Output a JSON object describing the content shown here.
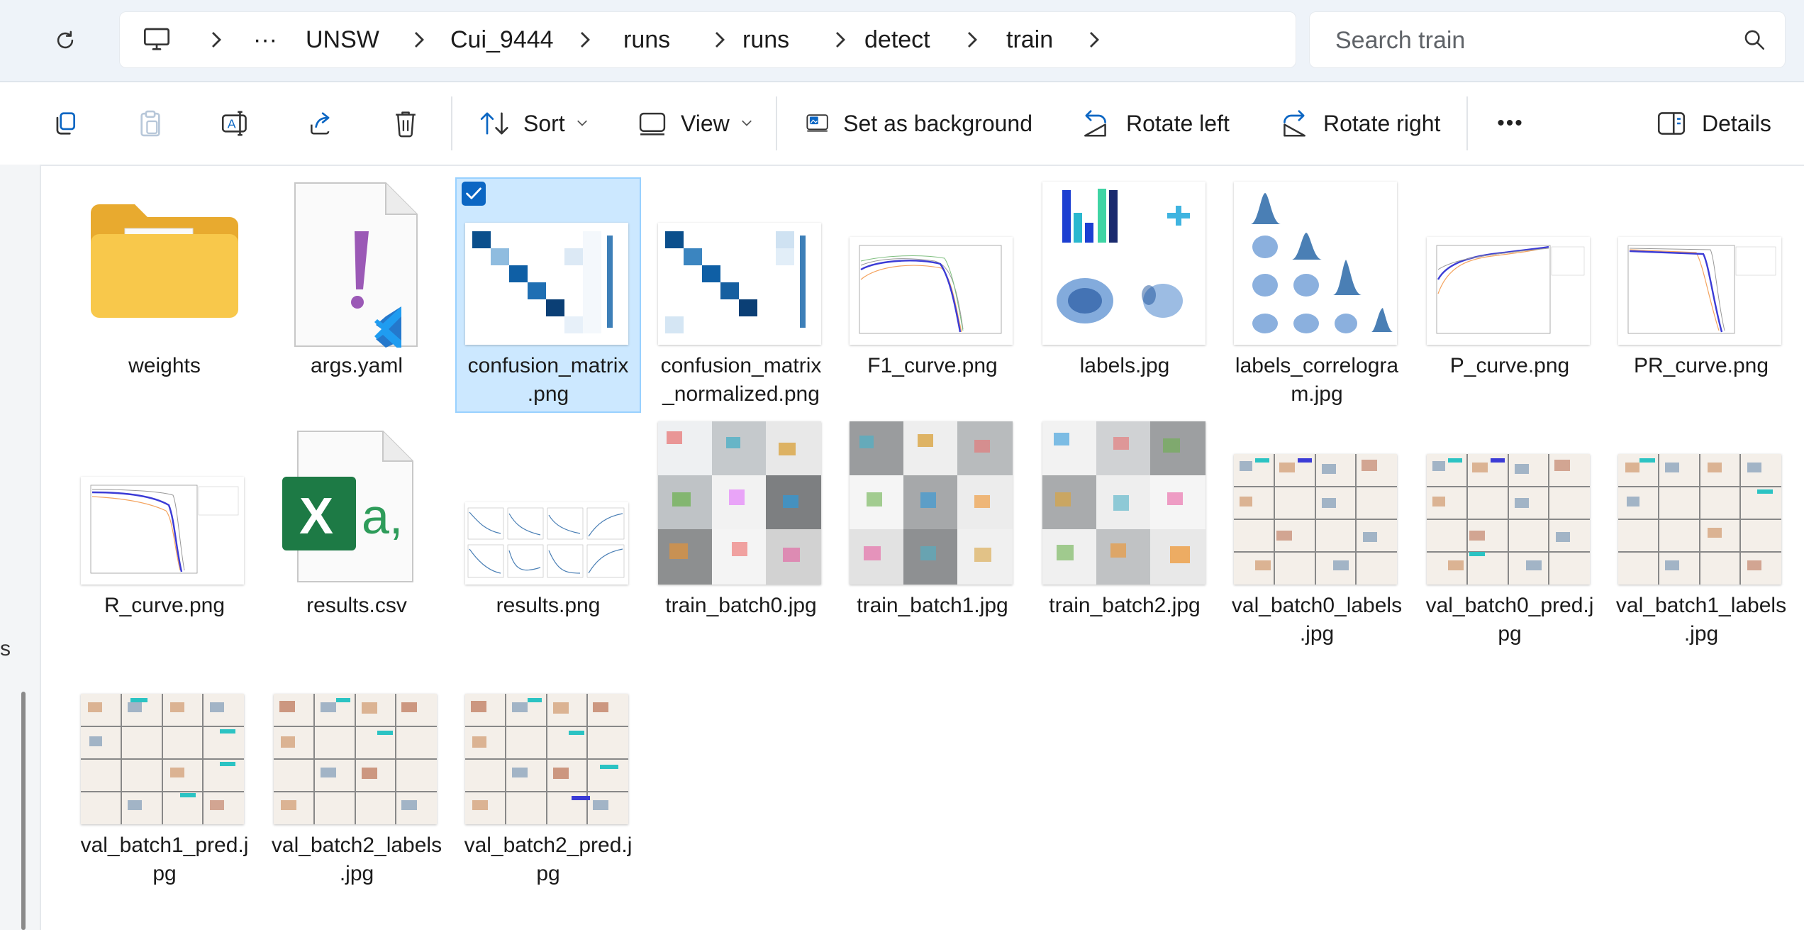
{
  "address_bar": {
    "breadcrumbs": [
      "UNSW",
      "Cui_9444",
      "runs",
      "runs",
      "detect",
      "train"
    ],
    "overflow": "···",
    "search_placeholder": "Search train"
  },
  "toolbar": {
    "sort_label": "Sort",
    "view_label": "View",
    "set_background_label": "Set as background",
    "rotate_left_label": "Rotate left",
    "rotate_right_label": "Rotate right",
    "more_label": "•••",
    "details_label": "Details"
  },
  "left_strip_text": "s",
  "files": [
    {
      "name": "weights",
      "kind": "folder"
    },
    {
      "name": "args.yaml",
      "kind": "yaml"
    },
    {
      "name": "confusion_matrix.png",
      "kind": "image",
      "selected": true
    },
    {
      "name": "confusion_matrix_normalized.png",
      "kind": "image"
    },
    {
      "name": "F1_curve.png",
      "kind": "image"
    },
    {
      "name": "labels.jpg",
      "kind": "image"
    },
    {
      "name": "labels_correlogram.jpg",
      "kind": "image"
    },
    {
      "name": "P_curve.png",
      "kind": "image"
    },
    {
      "name": "PR_curve.png",
      "kind": "image"
    },
    {
      "name": "R_curve.png",
      "kind": "image"
    },
    {
      "name": "results.csv",
      "kind": "csv"
    },
    {
      "name": "results.png",
      "kind": "image"
    },
    {
      "name": "train_batch0.jpg",
      "kind": "image"
    },
    {
      "name": "train_batch1.jpg",
      "kind": "image"
    },
    {
      "name": "train_batch2.jpg",
      "kind": "image"
    },
    {
      "name": "val_batch0_labels.jpg",
      "kind": "image"
    },
    {
      "name": "val_batch0_pred.jpg",
      "kind": "image"
    },
    {
      "name": "val_batch1_labels.jpg",
      "kind": "image"
    },
    {
      "name": "val_batch1_pred.jpg",
      "kind": "image"
    },
    {
      "name": "val_batch2_labels.jpg",
      "kind": "image"
    },
    {
      "name": "val_batch2_pred.jpg",
      "kind": "image"
    }
  ],
  "labels_display": [
    [
      "weights"
    ],
    [
      "args.yaml"
    ],
    [
      "confusion_matrix",
      ".png"
    ],
    [
      "confusion_matrix",
      "_normalized.png"
    ],
    [
      "F1_curve.png"
    ],
    [
      "labels.jpg"
    ],
    [
      "labels_correlogra",
      "m.jpg"
    ],
    [
      "P_curve.png"
    ],
    [
      "PR_curve.png"
    ],
    [
      "R_curve.png"
    ],
    [
      "results.csv"
    ],
    [
      "results.png"
    ],
    [
      "train_batch0.jpg"
    ],
    [
      "train_batch1.jpg"
    ],
    [
      "train_batch2.jpg"
    ],
    [
      "val_batch0_labels",
      ".jpg"
    ],
    [
      "val_batch0_pred.j",
      "pg"
    ],
    [
      "val_batch1_labels",
      ".jpg"
    ],
    [
      "val_batch1_pred.j",
      "pg"
    ],
    [
      "val_batch2_labels",
      ".jpg"
    ],
    [
      "val_batch2_pred.j",
      "pg"
    ]
  ],
  "colors": {
    "accent": "#0b66c3",
    "selection": "#cce8ff",
    "folder": "#f7c948",
    "excel": "#1d7a45",
    "vscode": "#2478cc",
    "yaml_mark": "#9b59b6"
  }
}
